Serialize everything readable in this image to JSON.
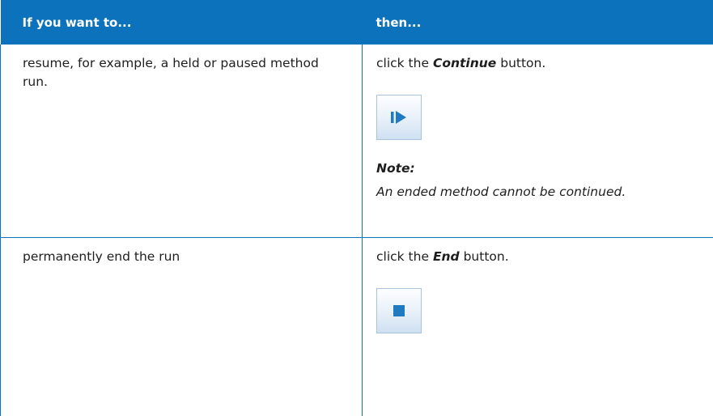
{
  "table": {
    "header": {
      "col1": "If you want to...",
      "col2": "then..."
    },
    "rows": [
      {
        "want": "resume, for example, a held or paused method run.",
        "then_prefix": "click the ",
        "then_button_name": "Continue",
        "then_suffix": " button.",
        "button_icon": "continue-icon",
        "note_title": "Note:",
        "note_text": "An ended method cannot be continued."
      },
      {
        "want": "permanently end the run",
        "then_prefix": "click the ",
        "then_button_name": "End",
        "then_suffix": " button.",
        "button_icon": "end-icon"
      }
    ]
  },
  "colors": {
    "header_bg": "#0b72bb",
    "icon_blue": "#1f7ac2"
  }
}
